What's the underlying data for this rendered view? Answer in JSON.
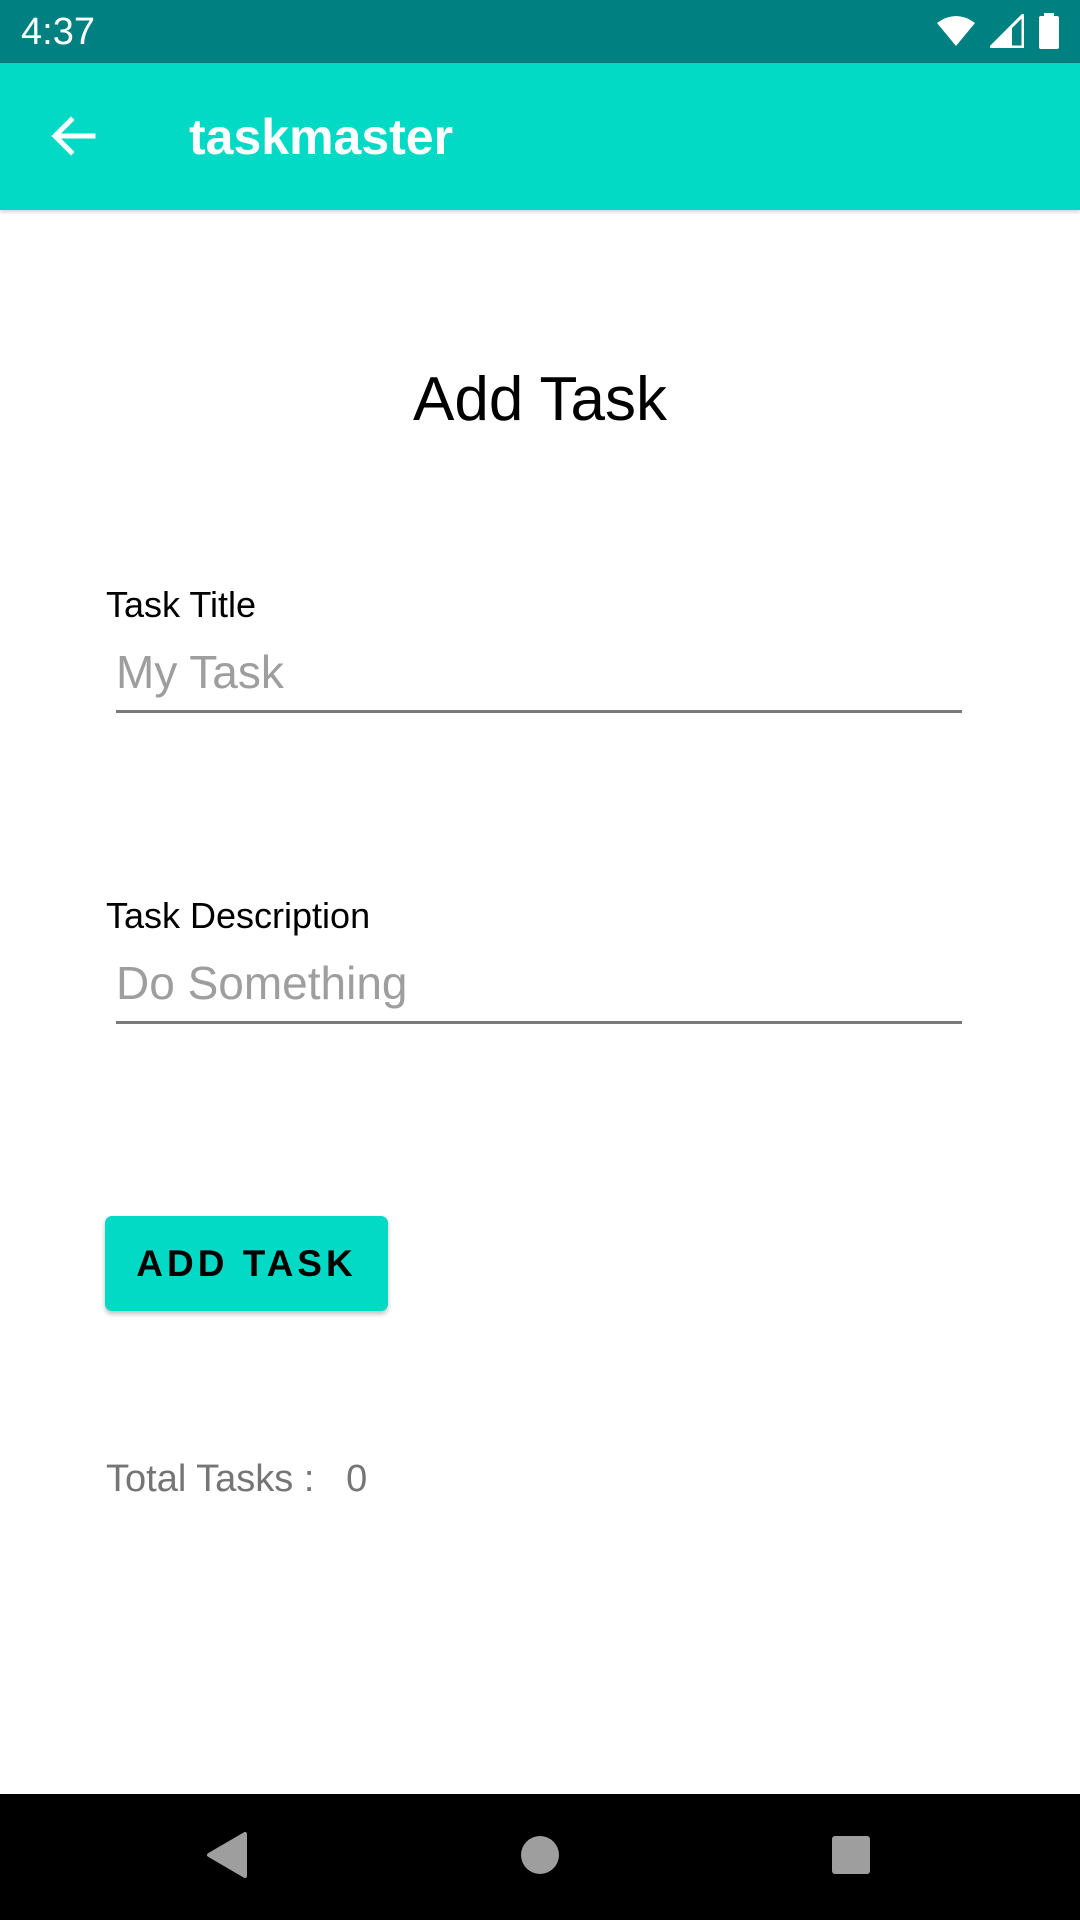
{
  "status_bar": {
    "time": "4:37",
    "icons": [
      "wifi-icon",
      "cell-signal-icon",
      "battery-icon"
    ]
  },
  "app_bar": {
    "title": "taskmaster",
    "back_icon": "arrow-back-icon",
    "background_color": "#03DAC5"
  },
  "page": {
    "title": "Add Task"
  },
  "form": {
    "title_label": "Task Title",
    "title_placeholder": "My Task",
    "description_label": "Task Description",
    "description_placeholder": "Do Something",
    "submit_label": "ADD TASK"
  },
  "summary": {
    "total_label": "Total Tasks :",
    "total_count": "0"
  },
  "nav_bar": {
    "buttons": [
      "back-triangle-icon",
      "home-circle-icon",
      "recents-square-icon"
    ]
  },
  "colors": {
    "status_bar": "#008080",
    "accent": "#03DAC5"
  }
}
